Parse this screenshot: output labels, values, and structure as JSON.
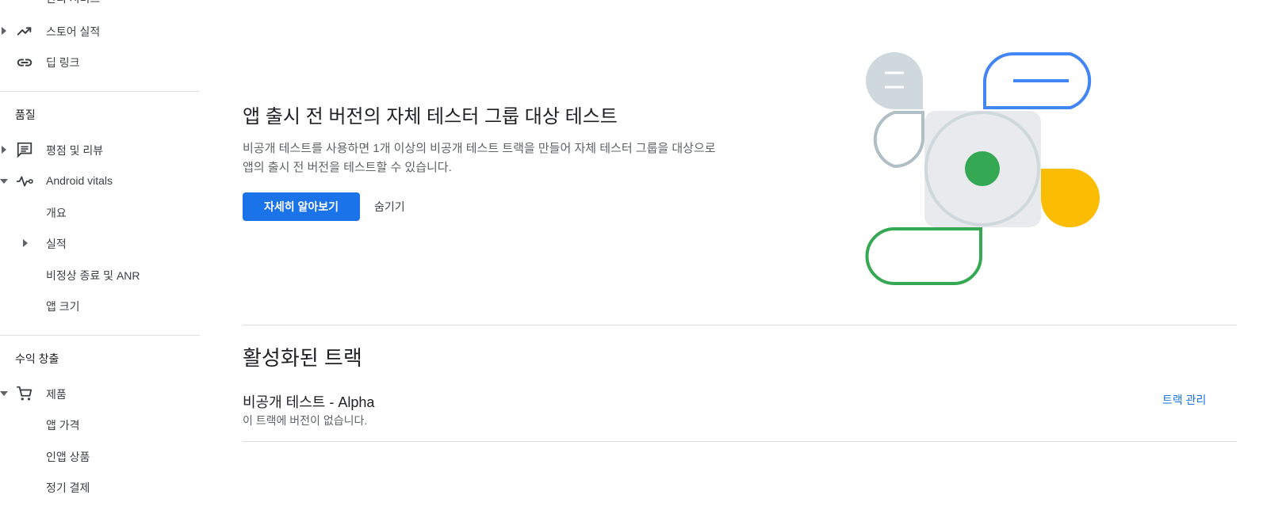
{
  "sidebar": {
    "cut_top_label": "관리 서비스",
    "store_performance": "스토어 실적",
    "deep_links": "딥 링크",
    "quality_header": "품질",
    "ratings_reviews": "평점 및 리뷰",
    "android_vitals": "Android vitals",
    "overview": "개요",
    "performance": "실적",
    "crashes_anr": "비정상 종료 및 ANR",
    "app_size": "앱 크기",
    "monetize_header": "수익 창출",
    "products": "제품",
    "app_pricing": "앱 가격",
    "in_app_products": "인앱 상품",
    "subscriptions": "정기 결제"
  },
  "promo": {
    "title": "앱 출시 전 버전의 자체 테스터 그룹 대상 테스트",
    "description": "비공개 테스트를 사용하면 1개 이상의 비공개 테스트 트랙을 만들어 자체 테스터 그룹을 대상으로 앱의 출시 전 버전을 테스트할 수 있습니다.",
    "learn_more": "자세히 알아보기",
    "hide": "숨기기"
  },
  "active_tracks": {
    "title": "활성화된 트랙",
    "track_name": "비공개 테스트 - Alpha",
    "track_status": "이 트랙에 버전이 없습니다.",
    "manage_track": "트랙 관리"
  },
  "colors": {
    "primary": "#1a73e8",
    "illus_blue": "#4285f4",
    "illus_green": "#34a853",
    "illus_yellow": "#fbbc04",
    "illus_grey": "#cfd8dc"
  }
}
